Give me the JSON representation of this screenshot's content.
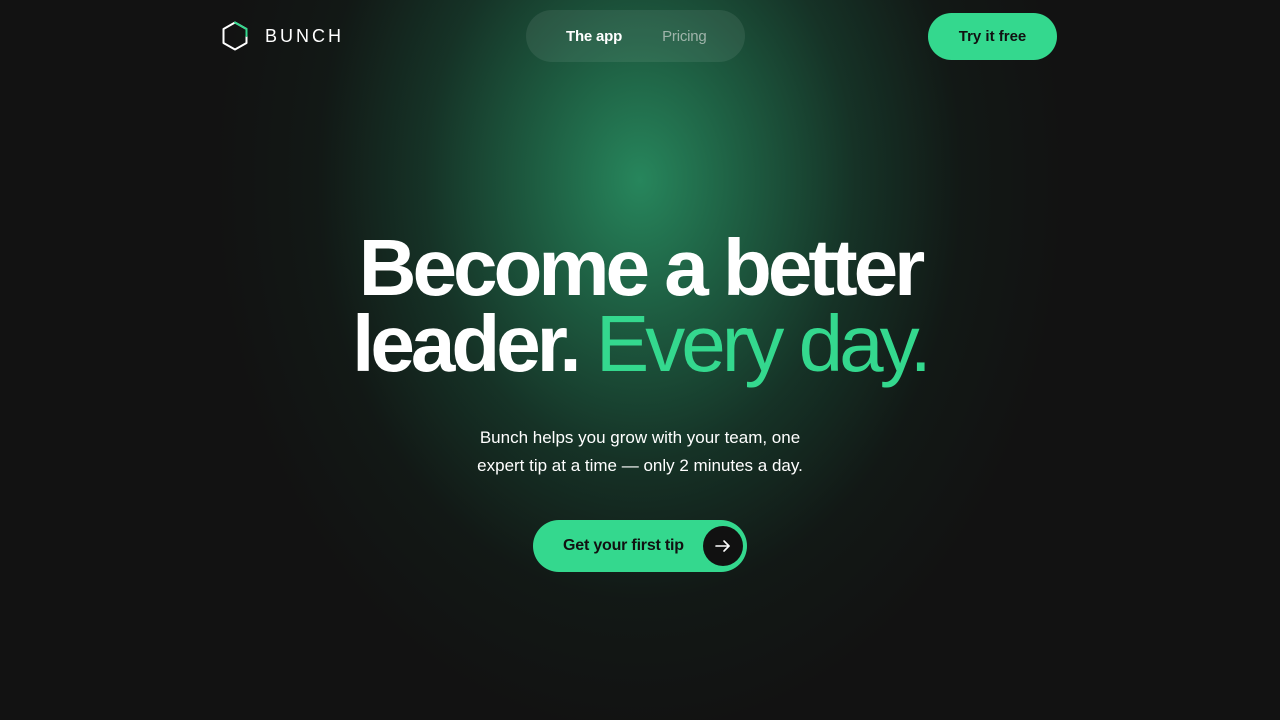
{
  "header": {
    "logo_text": "BUNCH",
    "nav": [
      {
        "label": "The app"
      },
      {
        "label": "Pricing"
      }
    ],
    "try_label": "Try it free"
  },
  "hero": {
    "title_line1": "Become a better",
    "title_line2_white": "leader.",
    "title_line2_accent": "Every day.",
    "subtitle_line1": "Bunch helps you grow with your team, one",
    "subtitle_line2": "expert tip at a time — only 2 minutes a day.",
    "cta_label": "Get your first tip"
  },
  "colors": {
    "accent": "#34d88e",
    "background": "#121212",
    "glow": "#288c60"
  },
  "icons": {
    "logo": "hexagon-logo-icon",
    "cta": "arrow-right-icon"
  }
}
